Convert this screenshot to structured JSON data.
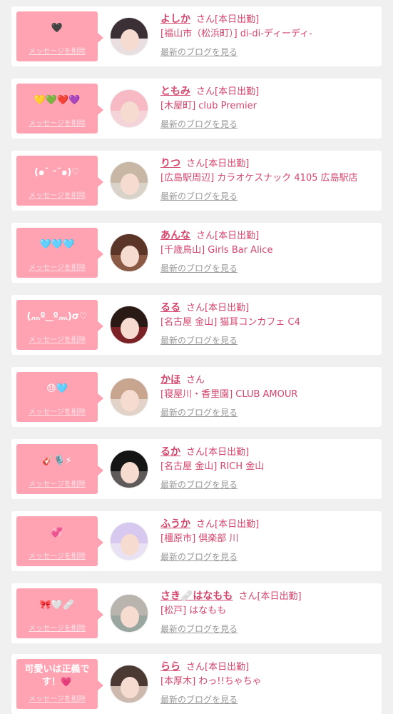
{
  "labels": {
    "delete": "メッセージを削除",
    "blog": "最新のブログを見る",
    "san": "さん"
  },
  "cards": [
    {
      "msg": "🖤",
      "name": "よしか",
      "status": "[本日出勤]",
      "shop": "[福山市（松浜町）] di-di-ディーディ-",
      "hair": "#3a3036",
      "bg": "#e9dfe0"
    },
    {
      "msg": "💛💚❤️💜",
      "name": "ともみ",
      "status": "[本日出勤]",
      "shop": "[木屋町] club Premier",
      "hair": "#f7b9c4",
      "bg": "#f5d4d9"
    },
    {
      "msg": "(๑˘ ᵕ˘๑)♡",
      "name": "りつ",
      "status": "[本日出勤]",
      "shop": "[広島駅周辺] カラオケスナック 4105 広島駅店",
      "hair": "#c9b7a6",
      "bg": "#d9d2c8"
    },
    {
      "msg": "🩵🩵🩵",
      "name": "あんな",
      "status": "[本日出勤]",
      "shop": "[千歳鳥山] Girls Bar Alice",
      "hair": "#5b3527",
      "bg": "#8a5a45"
    },
    {
      "msg": "(灬º‿º灬)σ♡",
      "name": "るる",
      "status": "[本日出勤]",
      "shop": "[名古屋 金山] 猫耳コンカフェ C4",
      "hair": "#2a1a16",
      "bg": "#7b2226"
    },
    {
      "msg": "😓🩵",
      "name": "かほ",
      "status": "",
      "shop": "[寝屋川・香里園] CLUB AMOUR",
      "hair": "#c8a58f",
      "bg": "#e2d2c8"
    },
    {
      "msg": "🎸🎙️⚡",
      "name": "るか",
      "status": "[本日出勤]",
      "shop": "[名古屋 金山] RICH 金山",
      "hair": "#151515",
      "bg": "#5e5a5a"
    },
    {
      "msg": "💞",
      "name": "ふうか",
      "status": "[本日出勤]",
      "shop": "[橿原市] 倶楽部 川",
      "hair": "#d6c8ee",
      "bg": "#e8e2f4"
    },
    {
      "msg": "🎀🤍🩹",
      "name": "さき🩹はなもも",
      "status": "[本日出勤]",
      "shop": "[松戸] はなもも",
      "hair": "#b9b4ae",
      "bg": "#9aa6a0"
    },
    {
      "msg": "可愛いは正義です！💗",
      "name": "らら",
      "status": "[本日出勤]",
      "shop": "[本厚木] わっ!!ちゃちゃ",
      "hair": "#4a3a33",
      "bg": "#cdb9ae"
    }
  ]
}
